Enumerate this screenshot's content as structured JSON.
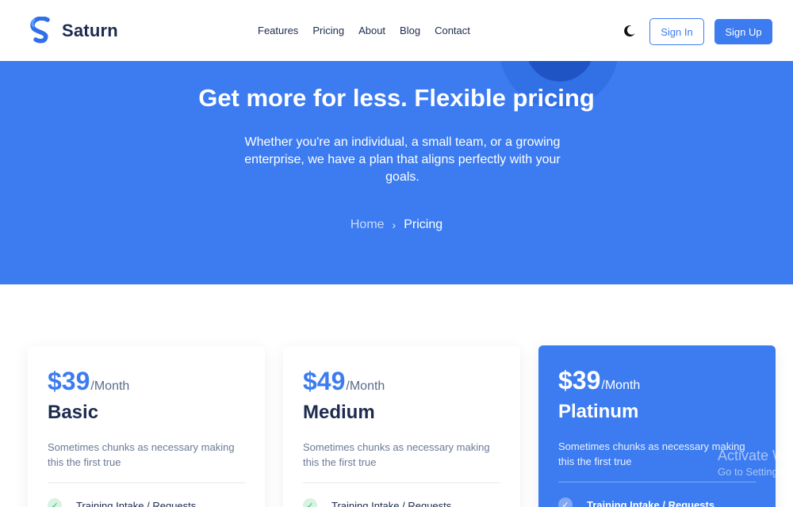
{
  "brand": {
    "name": "Saturn",
    "accent": "#3c7cf0",
    "dark": "#1d2b4f"
  },
  "nav": {
    "links": [
      "Features",
      "Pricing",
      "About",
      "Blog",
      "Contact"
    ],
    "theme_icon": "moon-icon",
    "signin_label": "Sign In",
    "signup_label": "Sign Up"
  },
  "hero": {
    "title": "Get more for less. Flexible pricing",
    "subtitle": "Whether you're an individual, a small team, or a growing enterprise, we have a plan that aligns perfectly with your goals.",
    "breadcrumb": {
      "home": "Home",
      "separator": "›",
      "current": "Pricing"
    }
  },
  "plans": [
    {
      "price": "$39",
      "period": "/Month",
      "name": "Basic",
      "description": "Sometimes chunks as necessary making this the first true",
      "feature": "Training Intake / Requests"
    },
    {
      "price": "$49",
      "period": "/Month",
      "name": "Medium",
      "description": "Sometimes chunks as necessary making this the first true",
      "feature": "Training Intake / Requests"
    },
    {
      "price": "$39",
      "period": "/Month",
      "name": "Platinum",
      "description": "Sometimes chunks as necessary making this the first true",
      "feature": "Training Intake / Requests"
    }
  ],
  "watermark": {
    "title": "Activate W",
    "subtitle": "Go to Settings"
  }
}
